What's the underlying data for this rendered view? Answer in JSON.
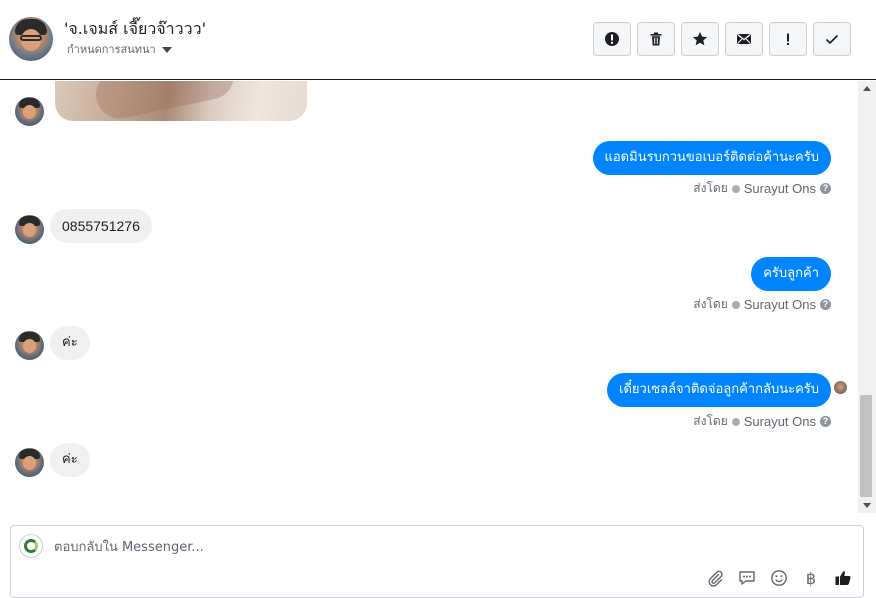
{
  "header": {
    "contact_name": "'จ.เจมส์ เจี๊ยวจ๊าววว'",
    "subtitle": "กำหนดการสนทนา"
  },
  "actions": [
    {
      "name": "report-button",
      "icon": "alert-circle-icon"
    },
    {
      "name": "delete-button",
      "icon": "trash-icon"
    },
    {
      "name": "star-button",
      "icon": "star-icon"
    },
    {
      "name": "mark-unread-button",
      "icon": "envelope-icon"
    },
    {
      "name": "important-button",
      "icon": "exclamation-icon"
    },
    {
      "name": "done-button",
      "icon": "check-icon"
    }
  ],
  "messages": {
    "m1": "แอดมินรบกวนขอเบอร์ติดต่อค้านะครับ",
    "m2": "0855751276",
    "m3": "ครับลูกค้า",
    "m4": "ค่ะ",
    "m5": "เดี๋ยวเซลล์จาติดจ่อลูกค้ากลับนะครับ",
    "m6": "ค่ะ"
  },
  "sent_by": {
    "prefix": "ส่งโดย",
    "author": "Surayut Ons"
  },
  "composer": {
    "placeholder": "ตอบกลับใน Messenger...",
    "currency_symbol": "฿"
  },
  "colors": {
    "outgoing_bubble": "#0084ff",
    "incoming_bubble": "#f0f0f0"
  }
}
